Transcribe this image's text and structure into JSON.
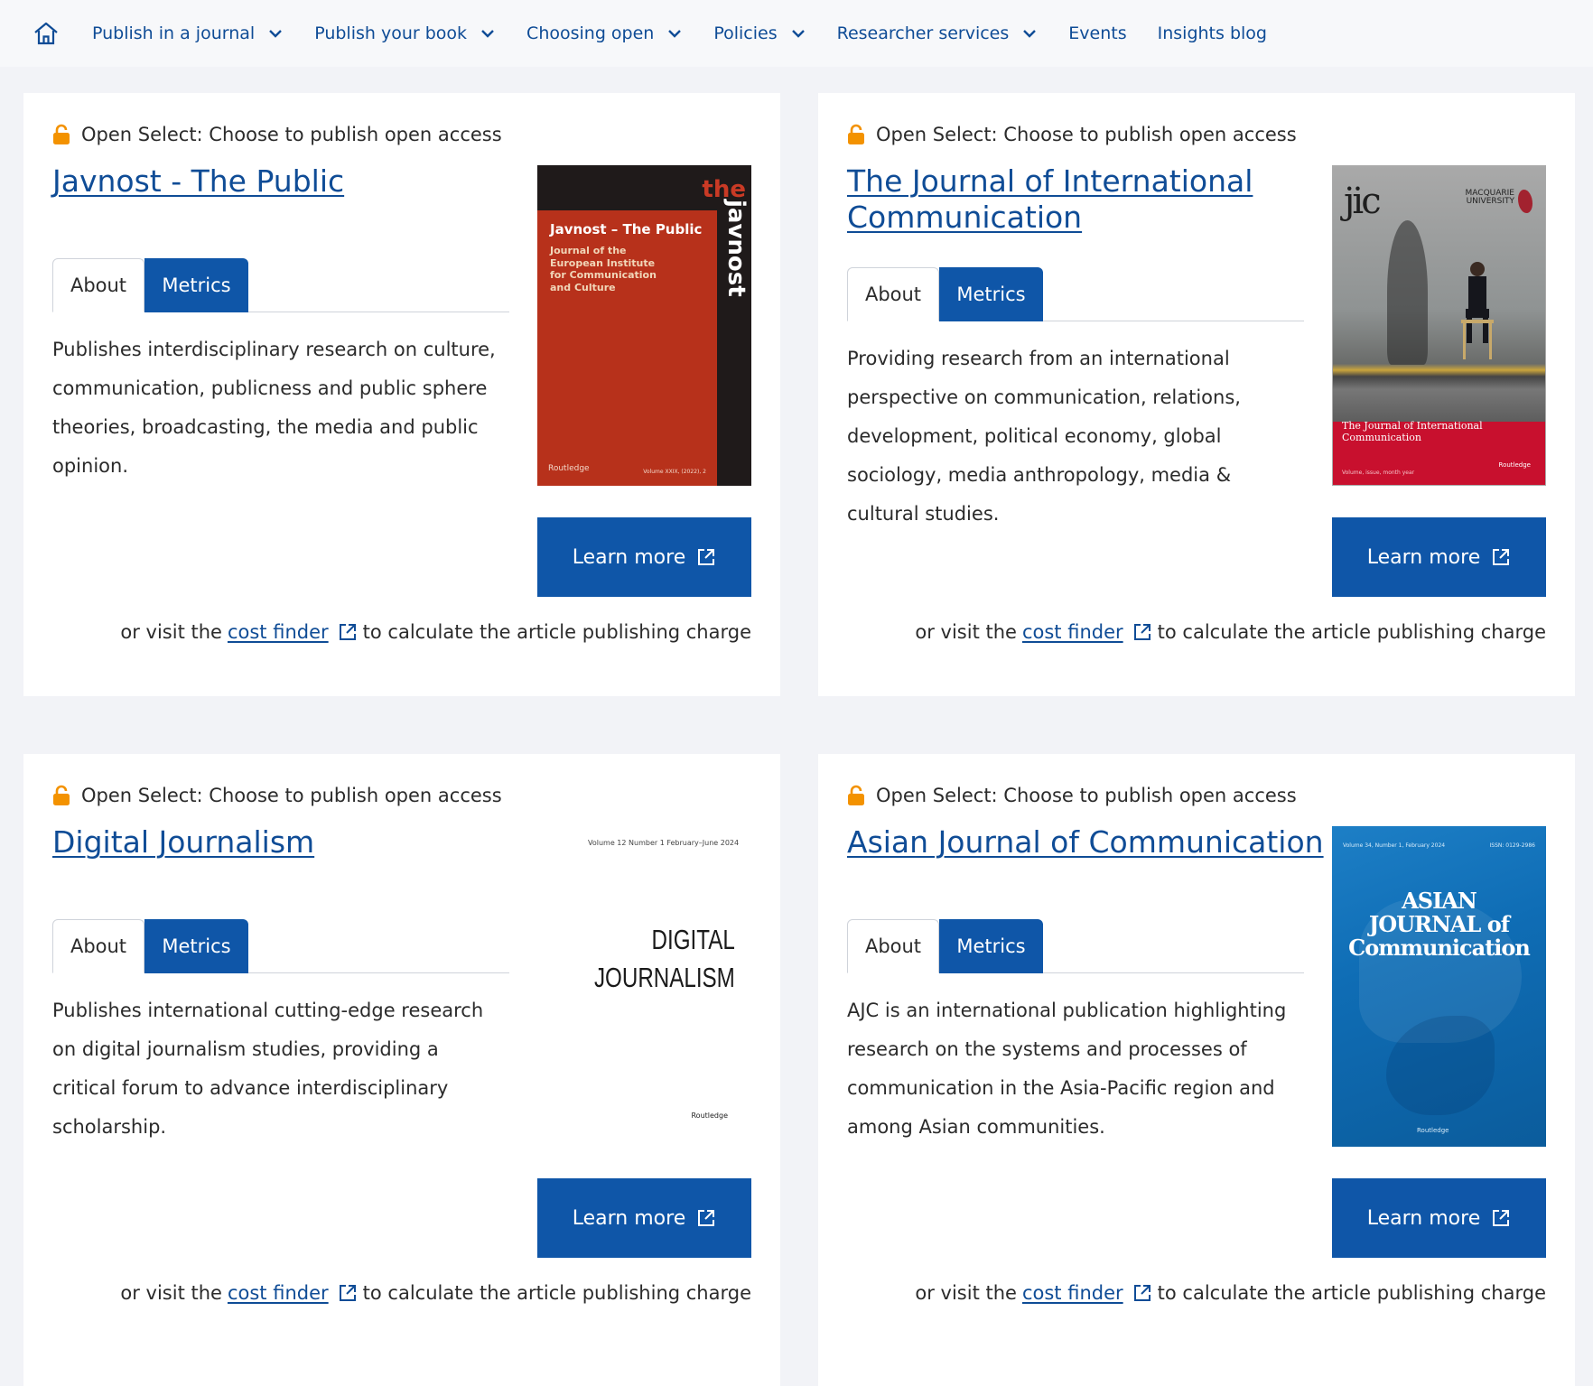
{
  "nav": {
    "items": [
      {
        "label": "Publish in a journal",
        "dropdown": true
      },
      {
        "label": "Publish your book",
        "dropdown": true
      },
      {
        "label": "Choosing open",
        "dropdown": true
      },
      {
        "label": "Policies",
        "dropdown": true
      },
      {
        "label": "Researcher services",
        "dropdown": true
      },
      {
        "label": "Events",
        "dropdown": false
      },
      {
        "label": "Insights blog",
        "dropdown": false
      }
    ]
  },
  "common": {
    "open_select": "Open Select: Choose to publish open access",
    "tab_about": "About",
    "tab_metrics": "Metrics",
    "learn_more": "Learn more",
    "cost_prefix": "or visit the",
    "cost_link": "cost finder",
    "cost_suffix": "to calculate the article publishing charge"
  },
  "colors": {
    "brand_blue": "#0f56a8",
    "link_blue": "#0f4c96",
    "lock_orange": "#f39200"
  },
  "journals": [
    {
      "title": "Javnost - The Public",
      "description": "Publishes interdisciplinary research on culture, communication, publicness and public sphere theories, broadcasting, the media and public opinion.",
      "cover": {
        "the": "the",
        "vertical": "javnost",
        "title": "Javnost – The Public",
        "subtitle": "Journal of the European Institute for Communication and Culture",
        "publisher": "Routledge",
        "volume": "Volume XXIX, (2022), 2"
      }
    },
    {
      "title": "The Journal of International Communication",
      "description": "Providing research from an international perspective on communication, relations, development, political economy, global sociology, media anthropology, media & cultural studies.",
      "cover": {
        "logo": "jic",
        "uni": "MACQUARIE UNIVERSITY",
        "title": "The Journal of International Communication",
        "volume": "Volume, issue, month year",
        "publisher": "Routledge"
      }
    },
    {
      "title": "Digital Journalism",
      "description": "Publishes international cutting-edge research on digital journalism studies, providing a critical forum to advance interdisciplinary scholarship.",
      "cover": {
        "header": "Volume 12   Number 1   February–June 2024",
        "line1": "DIGITAL",
        "line2": "JOURNALISM",
        "publisher": "Routledge"
      }
    },
    {
      "title": "Asian Journal of Communication",
      "description": "AJC is an international publication highlighting research on the systems and processes of communication in the Asia-Pacific region and among Asian communities.",
      "cover": {
        "header": "Volume 34, Number 1, February 2024",
        "issn": "ISSN: 0129-2986",
        "line1": "ASIAN",
        "line2": "JOURNAL of",
        "line3": "Communication",
        "publisher": "Routledge"
      }
    }
  ]
}
